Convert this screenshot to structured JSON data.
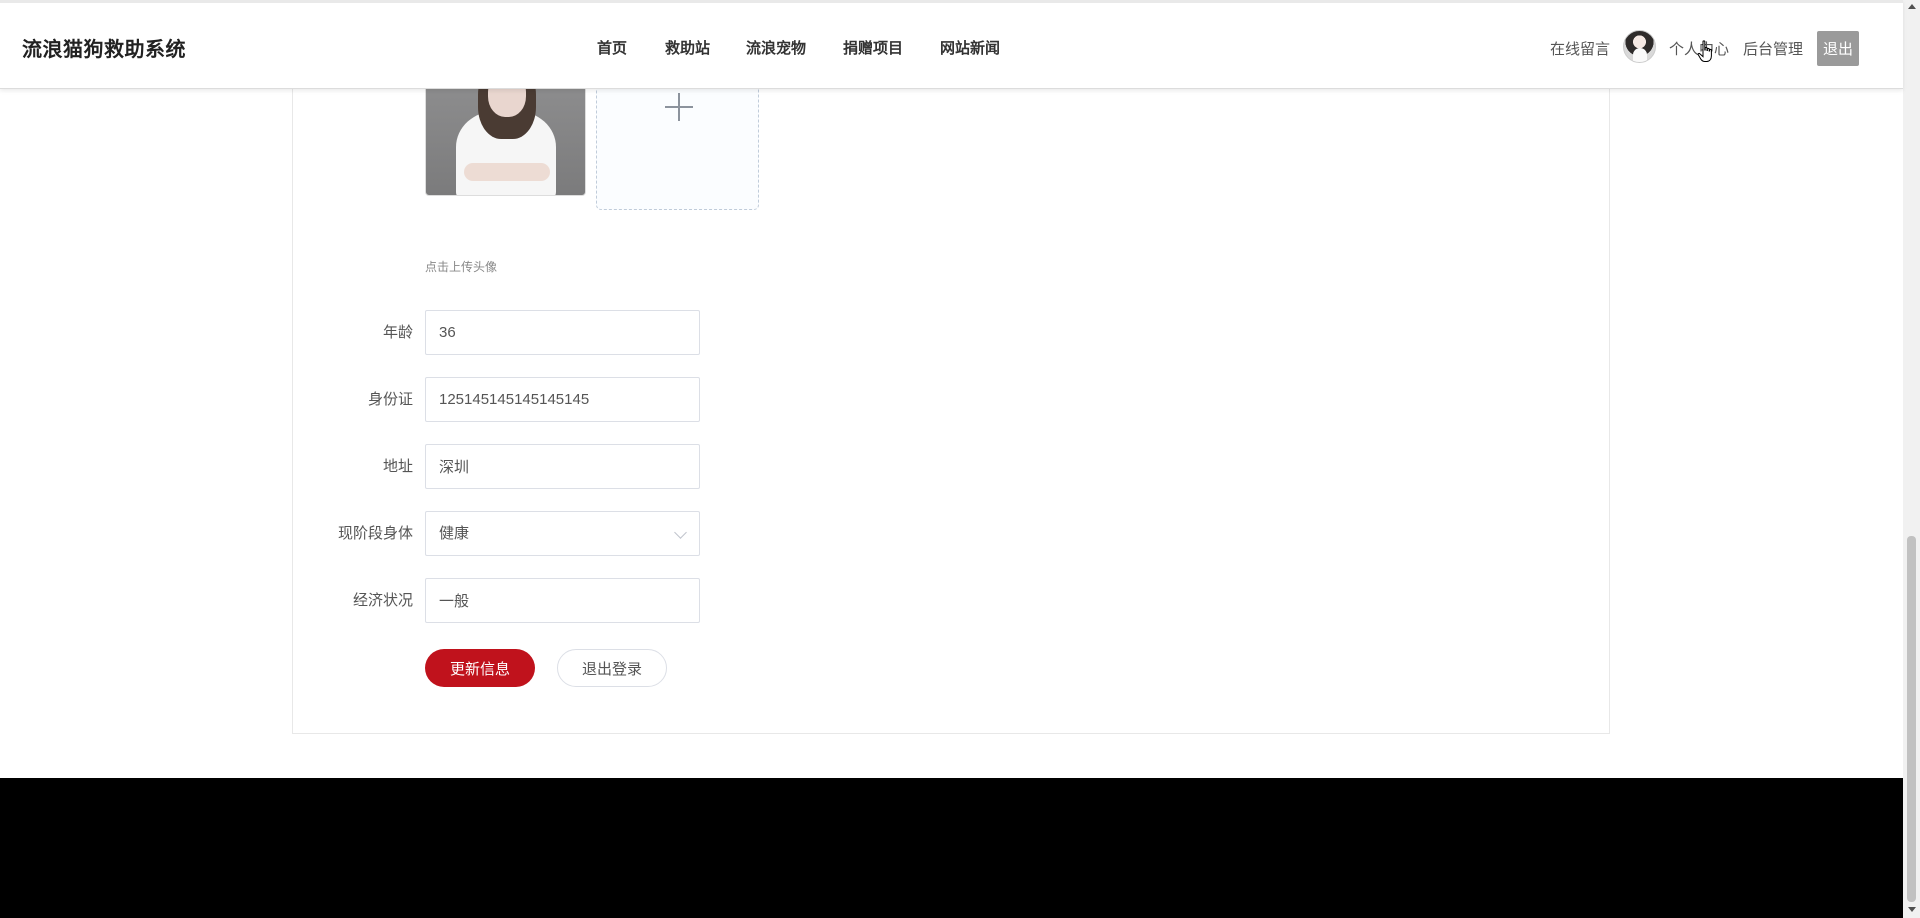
{
  "header": {
    "brand": "流浪猫狗救助系统",
    "nav": [
      {
        "label": "首页"
      },
      {
        "label": "救助站"
      },
      {
        "label": "流浪宠物"
      },
      {
        "label": "捐赠项目"
      },
      {
        "label": "网站新闻"
      }
    ],
    "message_link": "在线留言",
    "profile_link": "个人中心",
    "admin_link": "后台管理",
    "logout_label": "退出"
  },
  "profile_form": {
    "upload_tip": "点击上传头像",
    "fields": [
      {
        "label": "年龄",
        "value": "36"
      },
      {
        "label": "身份证",
        "value": "125145145145145145"
      },
      {
        "label": "地址",
        "value": "深圳"
      },
      {
        "label": "现阶段身体",
        "value": "健康",
        "type": "select"
      },
      {
        "label": "经济状况",
        "value": "一般"
      }
    ],
    "submit_label": "更新信息",
    "logout_label": "退出登录"
  },
  "colors": {
    "primary": "#c0121c",
    "logout_bg": "#9a9a9a",
    "footer": "#000000"
  },
  "icons": {
    "upload": "plus-icon",
    "select": "chevron-down-icon",
    "cursor": "hand-pointer-icon"
  }
}
